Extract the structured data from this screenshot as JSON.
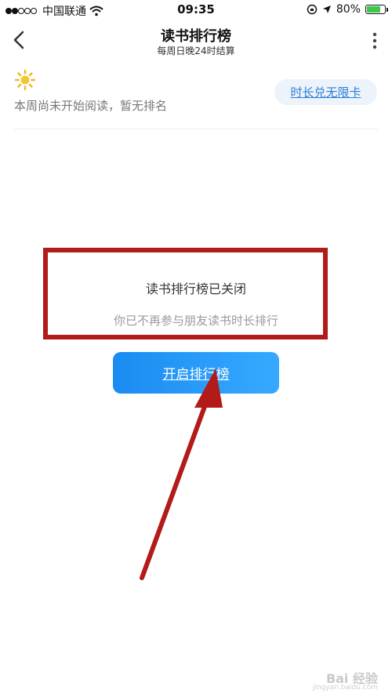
{
  "status_bar": {
    "carrier": "中国联通",
    "time": "09:35",
    "battery": "80%",
    "battery_level": 0.8,
    "battery_color": "#3cc84a"
  },
  "nav": {
    "title": "读书排行榜",
    "subtitle": "每周日晚24时结算"
  },
  "header": {
    "notice": "本周尚未开始阅读，暂无排名",
    "pill_label": "时长兑无限卡"
  },
  "empty_state": {
    "title": "读书排行榜已关闭",
    "description": "你已不再参与朋友读书时长排行",
    "button_label": "开启排行榜"
  },
  "watermark": {
    "text": "Bai 经验",
    "url_text": "jingyan.baidu.com"
  },
  "colors": {
    "accent_blue": "#2b7fd6",
    "button_blue": "#1a8cf2",
    "annotation_red": "#b31a1a"
  }
}
